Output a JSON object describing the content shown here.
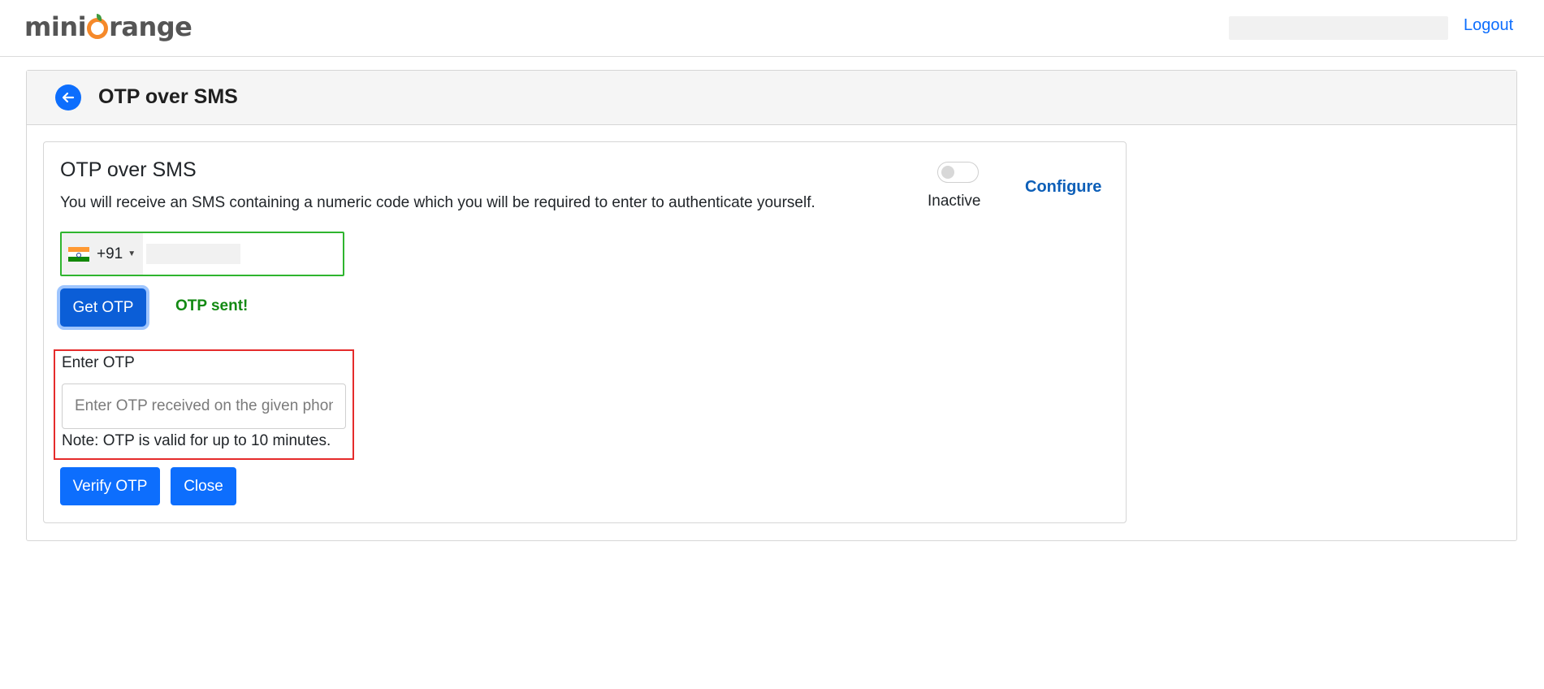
{
  "brand": {
    "logo_text_left": "mini",
    "logo_text_right": "range",
    "logo_accent": "#f5892a",
    "logo_leaf": "#3f9a3f"
  },
  "header": {
    "logout_label": "Logout"
  },
  "page": {
    "title": "OTP over SMS",
    "back_icon": "arrow-left-icon"
  },
  "method": {
    "title": "OTP over SMS",
    "description": "You will receive an SMS containing a numeric code which you will be required to enter to authenticate yourself.",
    "status_label": "Inactive",
    "enabled": false,
    "configure_label": "Configure"
  },
  "phone": {
    "country_flag": "india-flag-icon",
    "dial_code": "+91",
    "number": ""
  },
  "actions": {
    "get_otp_label": "Get OTP",
    "otp_sent_text": "OTP sent!",
    "verify_label": "Verify OTP",
    "close_label": "Close"
  },
  "otp": {
    "label": "Enter OTP",
    "placeholder": "Enter OTP received on the given phone",
    "value": "",
    "note": "Note: OTP is valid for up to 10 minutes."
  },
  "colors": {
    "primary": "#0d6efd",
    "success": "#138a13",
    "highlight_border": "#e52b2b",
    "phone_border": "#2fb52f"
  }
}
